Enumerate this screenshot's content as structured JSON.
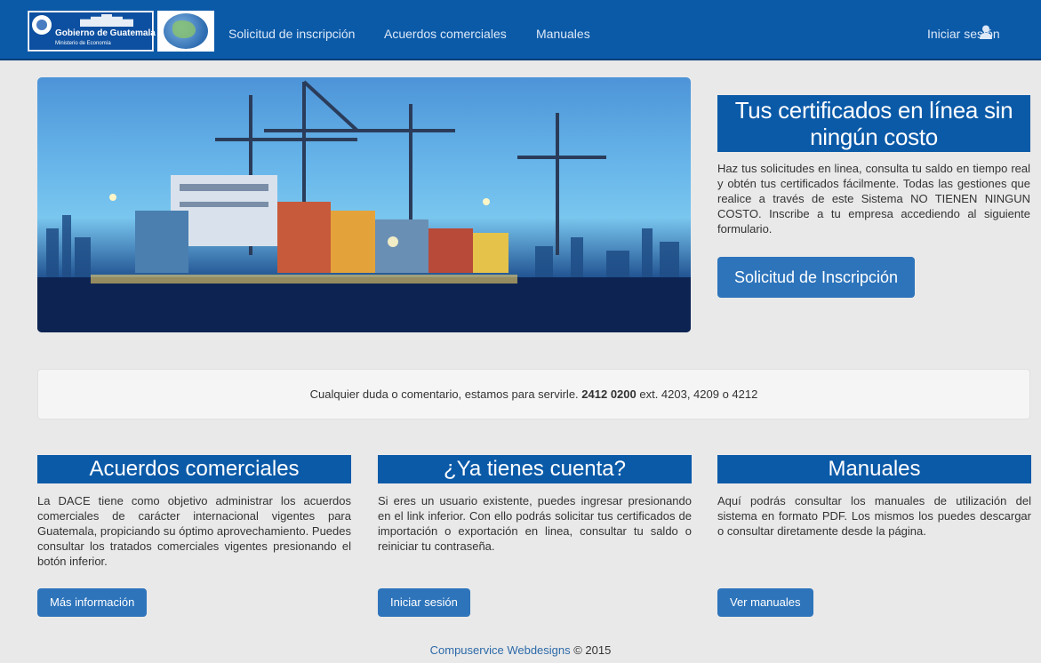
{
  "navbar": {
    "logo_gob": {
      "title": "Gobierno de Guatemala",
      "subtitle": "Ministerio de Economía"
    },
    "links": [
      "Solicitud de inscripción",
      "Acuerdos comerciales",
      "Manuales"
    ],
    "login_label": "Iniciar sesión"
  },
  "hero": {
    "tagline": "Tus certificados en línea sin ningún costo",
    "intro": "Haz tus solicitudes en linea, consulta tu saldo en tiempo real y obtén tus certificados fácilmente. Todas las gestiones que realice a través de este Sistema NO TIENEN NINGUN COSTO. Inscribe a tu empresa accediendo al siguiente formulario.",
    "button": "Solicitud de Inscripción"
  },
  "contact": {
    "prefix": "Cualquier duda o comentario, estamos para servirle. ",
    "phone": "2412 0200",
    "suffix": " ext. 4203, 4209 o 4212"
  },
  "columns": [
    {
      "title": "Acuerdos comerciales",
      "text": "La DACE tiene como objetivo administrar los acuerdos comerciales de carácter internacional vigentes para Guatemala, propiciando su óptimo aprovechamiento. Puedes consultar los tratados comerciales vigentes presionando el botón inferior.",
      "button": "Más información"
    },
    {
      "title": "¿Ya tienes cuenta?",
      "text": "Si eres un usuario existente, puedes ingresar presionando en el link inferior. Con ello podrás solicitar tus certificados de importación o exportación en linea, consultar tu saldo o reiniciar tu contraseña.",
      "button": "Iniciar sesión"
    },
    {
      "title": "Manuales",
      "text": "Aquí podrás consultar los manuales de utilización del sistema en formato PDF. Los mismos los puedes descargar o consultar diretamente desde la página.",
      "button": "Ver manuales"
    }
  ],
  "footer": {
    "link": "Compuservice Webdesigns",
    "copy": " © 2015"
  },
  "colors": {
    "primary": "#0b5aa8",
    "button": "#2d74bb",
    "background": "#e9e9e9"
  }
}
